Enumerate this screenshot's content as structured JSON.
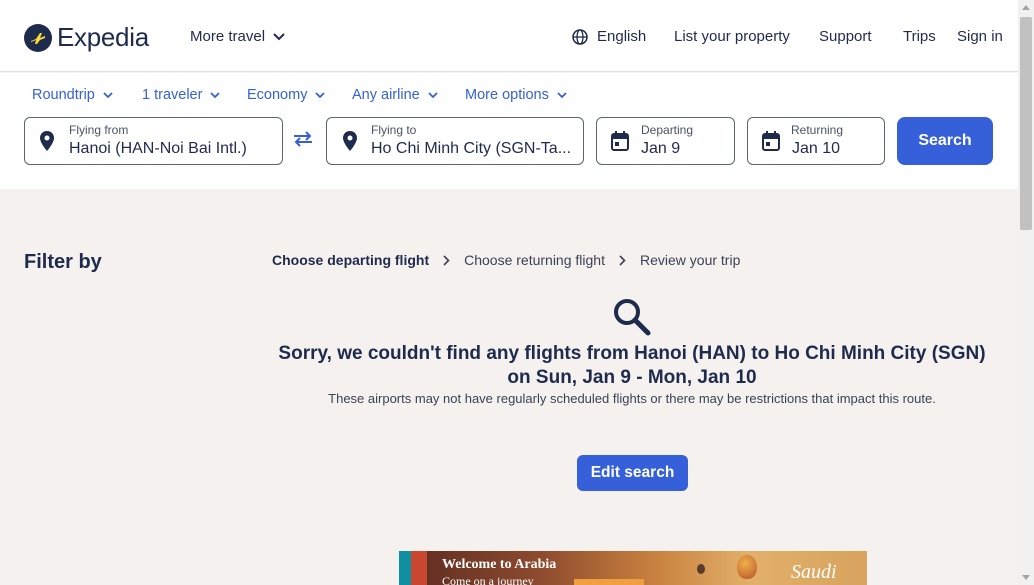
{
  "header": {
    "logo_text": "Expedia",
    "more_travel": "More travel",
    "language": "English",
    "list_property": "List your property",
    "support": "Support",
    "trips": "Trips",
    "sign_in": "Sign in"
  },
  "options": {
    "trip_type": "Roundtrip",
    "travelers": "1 traveler",
    "cabin": "Economy",
    "airline": "Any airline",
    "more_options": "More options"
  },
  "search": {
    "from_label": "Flying from",
    "from_value": "Hanoi (HAN-Noi Bai Intl.)",
    "to_label": "Flying to",
    "to_value": "Ho Chi Minh City (SGN-Ta...",
    "depart_label": "Departing",
    "depart_value": "Jan 9",
    "return_label": "Returning",
    "return_value": "Jan 10",
    "button": "Search"
  },
  "filter": {
    "title": "Filter by"
  },
  "breadcrumb": {
    "step1": "Choose departing flight",
    "step2": "Choose returning flight",
    "step3": "Review your trip"
  },
  "results": {
    "title_line1": "Sorry, we couldn't find any flights from Hanoi (HAN) to Ho Chi Minh City (SGN)",
    "title_line2": "on Sun, Jan 9 - Mon, Jan 10",
    "subtitle": "These airports may not have regularly scheduled flights or there may be restrictions that impact this route.",
    "edit_button": "Edit search"
  },
  "ad": {
    "headline": "Welcome to Arabia",
    "subline": "Come on a journey",
    "brand": "Saudi"
  },
  "colors": {
    "accent": "#3660d9",
    "text": "#1f2b4d",
    "background": "#f5f1ef"
  }
}
